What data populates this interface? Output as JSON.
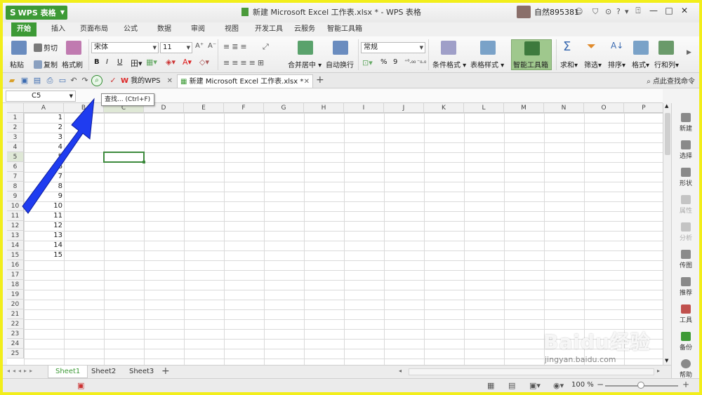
{
  "titlebar": {
    "app_button": "WPS 表格",
    "window_title": "新建 Microsoft Excel 工作表.xlsx * - WPS 表格",
    "user_name": "自然895381"
  },
  "ribbon_tabs": [
    "开始",
    "插入",
    "页面布局",
    "公式",
    "数据",
    "审阅",
    "视图",
    "开发工具",
    "云服务",
    "智能工具箱"
  ],
  "ribbon": {
    "paste": "粘贴",
    "cut": "剪切",
    "copy": "复制",
    "format_painter": "格式刷",
    "font_name": "宋体",
    "font_size": "11",
    "bold": "B",
    "italic": "I",
    "underline": "U",
    "merge_center": "合并居中",
    "wrap_text": "自动换行",
    "number_format": "常规",
    "percent": "%",
    "comma": "9",
    "conditional_format": "条件格式",
    "table_style": "表格样式",
    "smart_toolbox": "智能工具箱",
    "sum": "求和",
    "filter": "筛选",
    "sort": "排序",
    "format": "格式",
    "row_col": "行和列"
  },
  "doc_tabs": [
    {
      "label": "我的WPS"
    },
    {
      "label": "新建 Microsoft Excel 工作表.xlsx *"
    }
  ],
  "find_command": "点此查找命令",
  "tooltip": "查找... (Ctrl+F)",
  "name_box": "C5",
  "columns": [
    "A",
    "B",
    "C",
    "D",
    "E",
    "F",
    "G",
    "H",
    "I",
    "J",
    "K",
    "L",
    "M",
    "N",
    "O",
    "P"
  ],
  "rows": [
    "1",
    "2",
    "3",
    "4",
    "5",
    "6",
    "7",
    "8",
    "9",
    "10",
    "11",
    "12",
    "13",
    "14",
    "15",
    "16",
    "17",
    "18",
    "19",
    "20",
    "21",
    "22",
    "23",
    "24",
    "25"
  ],
  "column_a_values": [
    "1",
    "2",
    "3",
    "4",
    "5",
    "6",
    "7",
    "8",
    "9",
    "10",
    "11",
    "12",
    "13",
    "14",
    "15"
  ],
  "right_panel": [
    {
      "label": "新建",
      "enabled": true
    },
    {
      "label": "选择",
      "enabled": true
    },
    {
      "label": "形状",
      "enabled": true
    },
    {
      "label": "属性",
      "enabled": false
    },
    {
      "label": "分析",
      "enabled": false
    },
    {
      "label": "传图",
      "enabled": true
    },
    {
      "label": "推荐",
      "enabled": true
    },
    {
      "label": "工具",
      "enabled": true
    },
    {
      "label": "备份",
      "enabled": true
    },
    {
      "label": "帮助",
      "enabled": true
    }
  ],
  "sheets": [
    "Sheet1",
    "Sheet2",
    "Sheet3"
  ],
  "status": {
    "zoom": "100 %"
  },
  "watermark": {
    "logo": "Baidu经验",
    "url": "jingyan.baidu.com"
  },
  "colors": {
    "accent": "#3d9a36",
    "frame_border": "#f2ee1a",
    "frame_bg": "#1c2cc8",
    "arrow": "#1f3cf0"
  }
}
